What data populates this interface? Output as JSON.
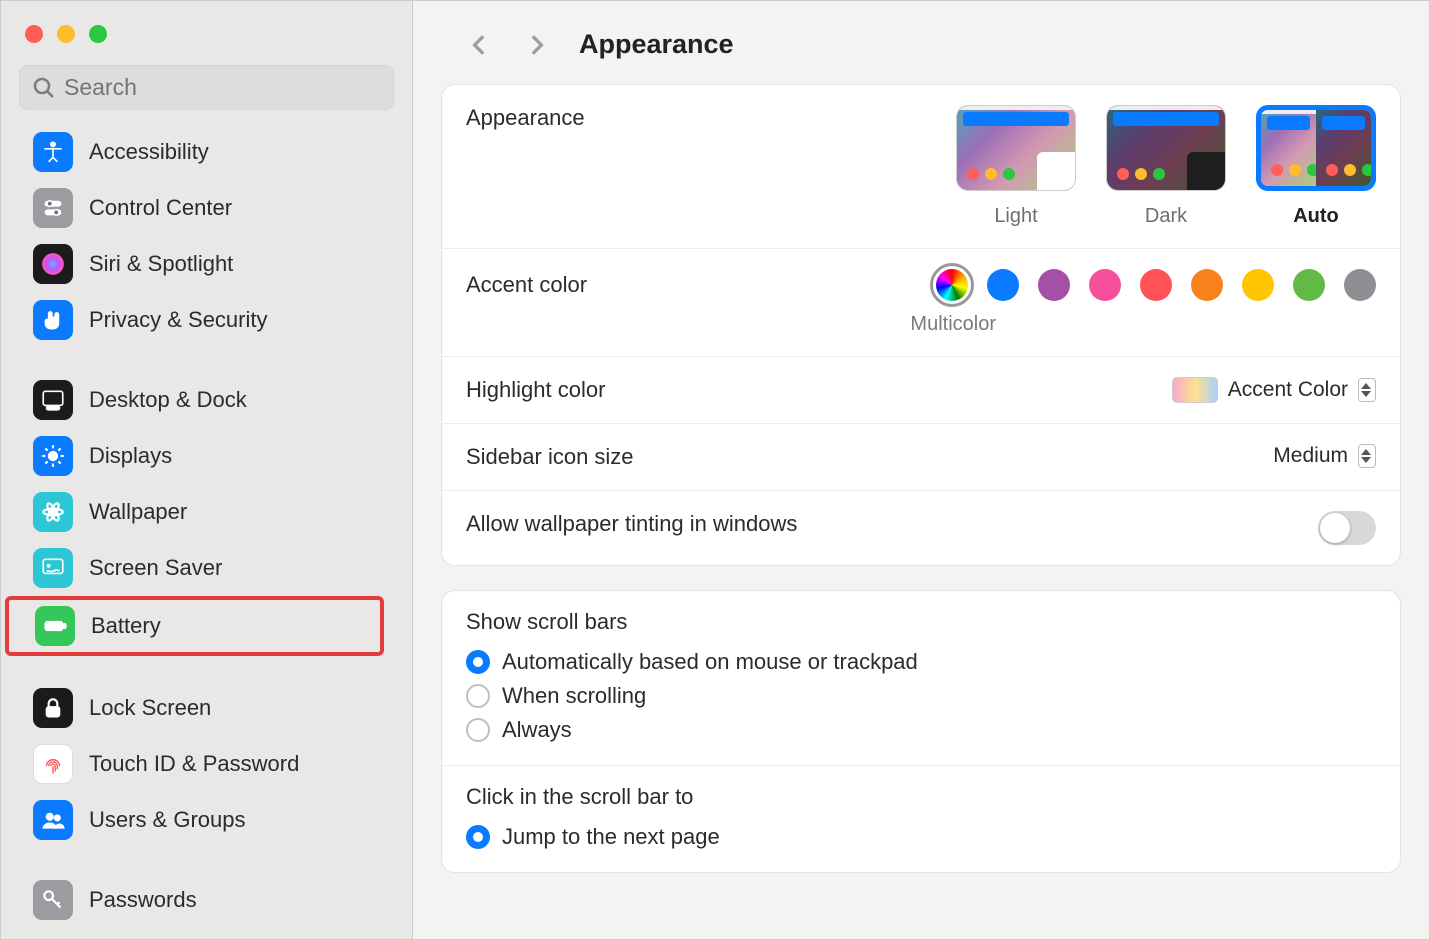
{
  "search": {
    "placeholder": "Search"
  },
  "sidebar": {
    "items": [
      {
        "id": "accessibility",
        "label": "Accessibility",
        "icon": "accessibility-icon",
        "bg": "#0a7aff",
        "fg": "#fff"
      },
      {
        "id": "control-center",
        "label": "Control Center",
        "icon": "sliders-icon",
        "bg": "#9c9ba0",
        "fg": "#fff"
      },
      {
        "id": "siri-spotlight",
        "label": "Siri & Spotlight",
        "icon": "siri-icon",
        "bg": "#1b1b1d",
        "fg": "#fff"
      },
      {
        "id": "privacy-security",
        "label": "Privacy & Security",
        "icon": "hand-icon",
        "bg": "#0a7aff",
        "fg": "#fff"
      },
      {
        "id": "desktop-dock",
        "label": "Desktop & Dock",
        "icon": "dock-icon",
        "bg": "#1b1b1d",
        "fg": "#fff"
      },
      {
        "id": "displays",
        "label": "Displays",
        "icon": "sun-icon",
        "bg": "#0a7aff",
        "fg": "#fff"
      },
      {
        "id": "wallpaper",
        "label": "Wallpaper",
        "icon": "flower-icon",
        "bg": "#2cc6d6",
        "fg": "#fff"
      },
      {
        "id": "screen-saver",
        "label": "Screen Saver",
        "icon": "screensaver-icon",
        "bg": "#2cc6d6",
        "fg": "#fff"
      },
      {
        "id": "battery",
        "label": "Battery",
        "icon": "battery-icon",
        "bg": "#34c759",
        "fg": "#fff"
      },
      {
        "id": "lock-screen",
        "label": "Lock Screen",
        "icon": "lock-icon",
        "bg": "#1b1b1d",
        "fg": "#fff"
      },
      {
        "id": "touch-id",
        "label": "Touch ID & Password",
        "icon": "fingerprint-icon",
        "bg": "#ffffff",
        "fg": "#ff4d4d"
      },
      {
        "id": "users-groups",
        "label": "Users & Groups",
        "icon": "users-icon",
        "bg": "#0a7aff",
        "fg": "#fff"
      },
      {
        "id": "passwords",
        "label": "Passwords",
        "icon": "key-icon",
        "bg": "#9c9ba0",
        "fg": "#fff"
      }
    ],
    "group_breaks": [
      4,
      9,
      12
    ],
    "highlighted_id": "battery"
  },
  "header": {
    "title": "Appearance"
  },
  "appearance": {
    "row_label": "Appearance",
    "options": [
      {
        "id": "light",
        "label": "Light"
      },
      {
        "id": "dark",
        "label": "Dark"
      },
      {
        "id": "auto",
        "label": "Auto"
      }
    ],
    "selected": "auto"
  },
  "accent": {
    "row_label": "Accent color",
    "sub_label": "Multicolor",
    "selected": "multicolor",
    "options": [
      "multicolor",
      "blue",
      "purple",
      "pink",
      "red",
      "orange",
      "yellow",
      "green",
      "gray"
    ]
  },
  "highlight": {
    "row_label": "Highlight color",
    "value": "Accent Color"
  },
  "sidebar_icon": {
    "row_label": "Sidebar icon size",
    "value": "Medium"
  },
  "tinting": {
    "row_label": "Allow wallpaper tinting in windows",
    "value": false
  },
  "scrollbars": {
    "title": "Show scroll bars",
    "options": [
      {
        "id": "auto",
        "label": "Automatically based on mouse or trackpad"
      },
      {
        "id": "scrolling",
        "label": "When scrolling"
      },
      {
        "id": "always",
        "label": "Always"
      }
    ],
    "selected": "auto"
  },
  "click_scrollbar": {
    "title": "Click in the scroll bar to",
    "options": [
      {
        "id": "next-page",
        "label": "Jump to the next page"
      }
    ],
    "selected": "next-page"
  }
}
